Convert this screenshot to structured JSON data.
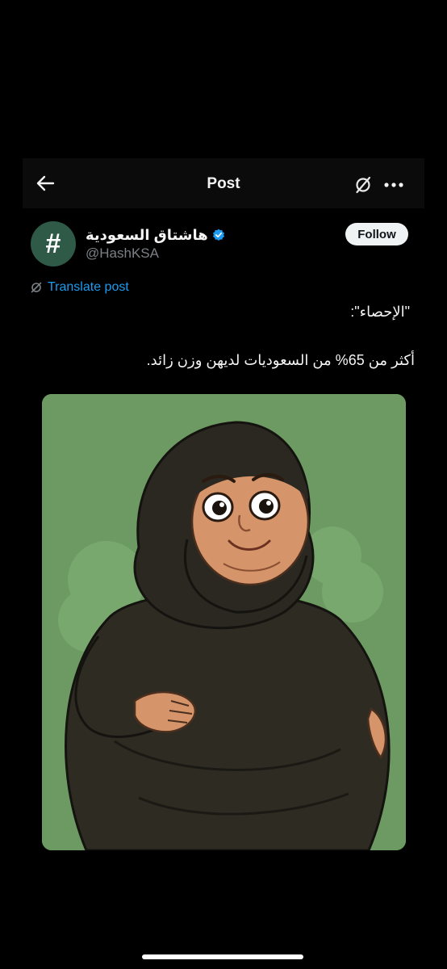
{
  "header": {
    "title": "Post",
    "back_icon": "back-arrow-icon",
    "translate_icon": "translate-icon",
    "more_icon": "more-icon"
  },
  "author": {
    "avatar_symbol": "#",
    "avatar_color": "#2f5a47",
    "display_name": "هاشتاق السعودية",
    "handle": "@HashKSA",
    "verified_color": "#1d9bf0"
  },
  "follow_button": {
    "label": "Follow"
  },
  "translate": {
    "label": "Translate post",
    "color": "#1d9bf0"
  },
  "post": {
    "line1": "\"الإحصاء\":",
    "line2": "أكثر من 65% من السعوديات لديهن وزن زائد."
  },
  "media": {
    "background_color": "#6c9a62"
  }
}
